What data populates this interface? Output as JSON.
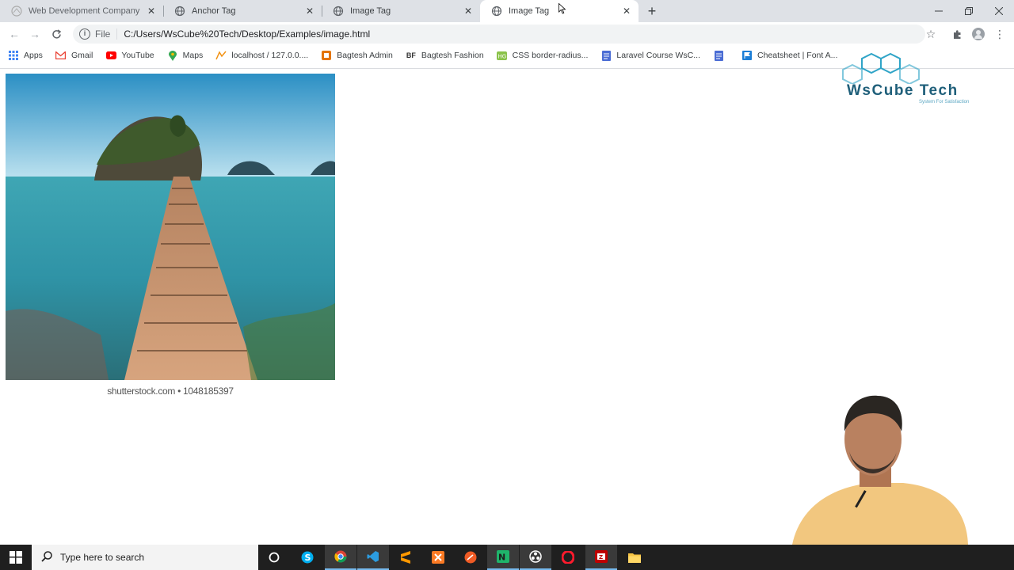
{
  "tabs": [
    {
      "title": "Web Development Company In...",
      "active": false
    },
    {
      "title": "Anchor Tag",
      "active": false
    },
    {
      "title": "Image Tag",
      "active": false
    },
    {
      "title": "Image Tag",
      "active": true
    }
  ],
  "address": {
    "scheme_label": "File",
    "url": "C:/Users/WsCube%20Tech/Desktop/Examples/image.html"
  },
  "bookmarks": [
    {
      "label": "Apps",
      "icon": "apps-grid-icon"
    },
    {
      "label": "Gmail",
      "icon": "gmail-icon"
    },
    {
      "label": "YouTube",
      "icon": "youtube-icon"
    },
    {
      "label": "Maps",
      "icon": "maps-pin-icon"
    },
    {
      "label": "localhost / 127.0.0....",
      "icon": "phpmyadmin-icon"
    },
    {
      "label": "Bagtesh Admin",
      "icon": "bookmark-icon"
    },
    {
      "label": "Bagtesh Fashion",
      "icon": "bf-icon"
    },
    {
      "label": "CSS border-radius...",
      "icon": "css-icon"
    },
    {
      "label": "Laravel Course WsC...",
      "icon": "doc-icon"
    },
    {
      "label": "",
      "icon": "doc-icon"
    },
    {
      "label": "Cheatsheet | Font A...",
      "icon": "flag-icon"
    }
  ],
  "page": {
    "caption": "shutterstock.com • 1048185397"
  },
  "logo": {
    "name": "WsCube Tech",
    "tagline": "System For Satisfaction"
  },
  "taskbar": {
    "search_placeholder": "Type here to search",
    "apps": [
      "cortana-icon",
      "skype-icon",
      "chrome-icon",
      "vscode-icon",
      "sublime-icon",
      "xampp-icon",
      "postman-icon",
      "notepadpp-icon",
      "obs-icon",
      "opera-icon",
      "filezilla-icon",
      "file-explorer-icon"
    ]
  },
  "colors": {
    "tabstrip": "#dee1e6",
    "taskbar": "#1f1f1f",
    "brand": "#1f5f7a"
  }
}
